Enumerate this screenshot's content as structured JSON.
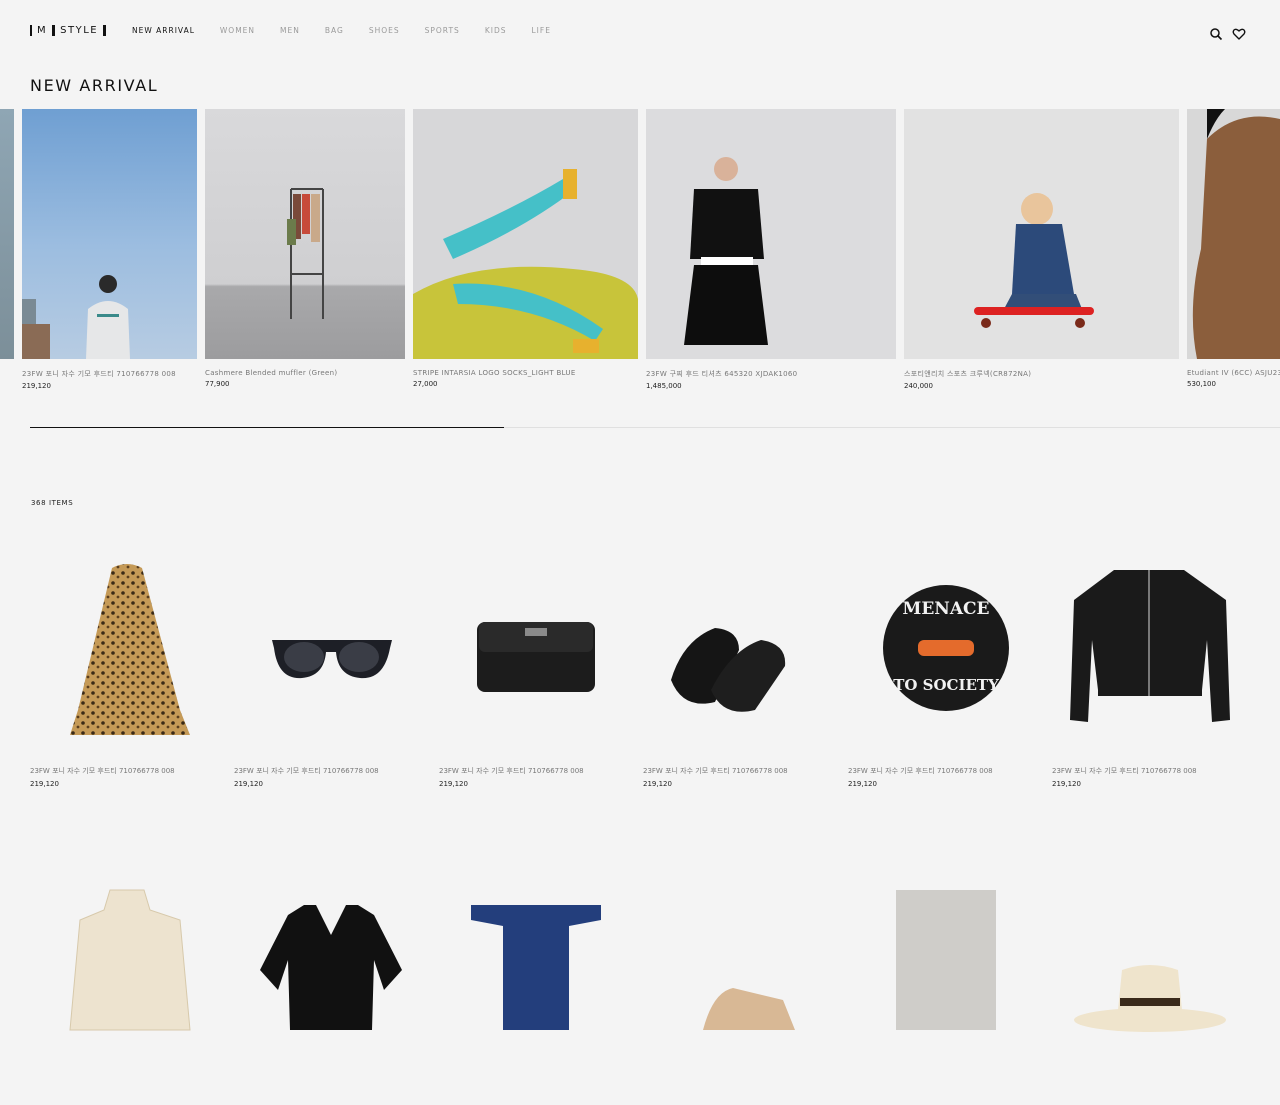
{
  "header": {
    "logo": {
      "left": "M",
      "right": "STYLE"
    },
    "nav": [
      {
        "label": "NEW ARRIVAL",
        "active": true
      },
      {
        "label": "WOMEN"
      },
      {
        "label": "MEN"
      },
      {
        "label": "BAG"
      },
      {
        "label": "SHOES"
      },
      {
        "label": "SPORTS"
      },
      {
        "label": "KIDS"
      },
      {
        "label": "LIFE"
      }
    ],
    "icons": [
      "search-icon",
      "heart-icon"
    ]
  },
  "new_arrival": {
    "title": "NEW ARRIVAL",
    "items": [
      {
        "name": "23FW 포니 자수 기모 후드티 710766778 008",
        "price": "219,120"
      },
      {
        "name": "Cashmere Blended muffler (Green)",
        "price": "77,900"
      },
      {
        "name": "STRIPE INTARSIA LOGO SOCKS_LIGHT BLUE",
        "price": "27,000"
      },
      {
        "name": "23FW 구찌 후드 티셔츠 645320 XJDAK1060",
        "price": "1,485,000"
      },
      {
        "name": "스포티앤리치 스포츠 크루넥(CR872NA)",
        "price": "240,000"
      },
      {
        "name": "Etudiant IV (6CC) ASJU23",
        "price": "530,100"
      }
    ]
  },
  "list": {
    "count": "368 ITEMS",
    "products": [
      {
        "name": "23FW 포니 자수 기모 후드티 710766778 008",
        "price": "219,120",
        "icon": "leopard-cape-icon"
      },
      {
        "name": "23FW 포니 자수 기모 후드티 710766778 008",
        "price": "219,120",
        "icon": "sunglasses-icon"
      },
      {
        "name": "23FW 포니 자수 기모 후드티 710766778 008",
        "price": "219,120",
        "icon": "leather-bag-icon"
      },
      {
        "name": "23FW 포니 자수 기모 후드티 710766778 008",
        "price": "219,120",
        "icon": "loafer-mules-icon"
      },
      {
        "name": "23FW 포니 자수 기모 후드티 710766778 008",
        "price": "219,120",
        "icon": "menace-patch-icon"
      },
      {
        "name": "23FW 포니 자수 기모 후드티 710766778 008",
        "price": "219,120",
        "icon": "bomber-jacket-icon"
      }
    ],
    "patch_text": {
      "top": "MENACE",
      "bottom": "TO SOCIETY"
    },
    "next_row_icons": [
      "blouse-icon",
      "black-blouse-icon",
      "velvet-top-icon",
      "shoe-icon",
      "scarf-icon",
      "hat-icon"
    ]
  }
}
